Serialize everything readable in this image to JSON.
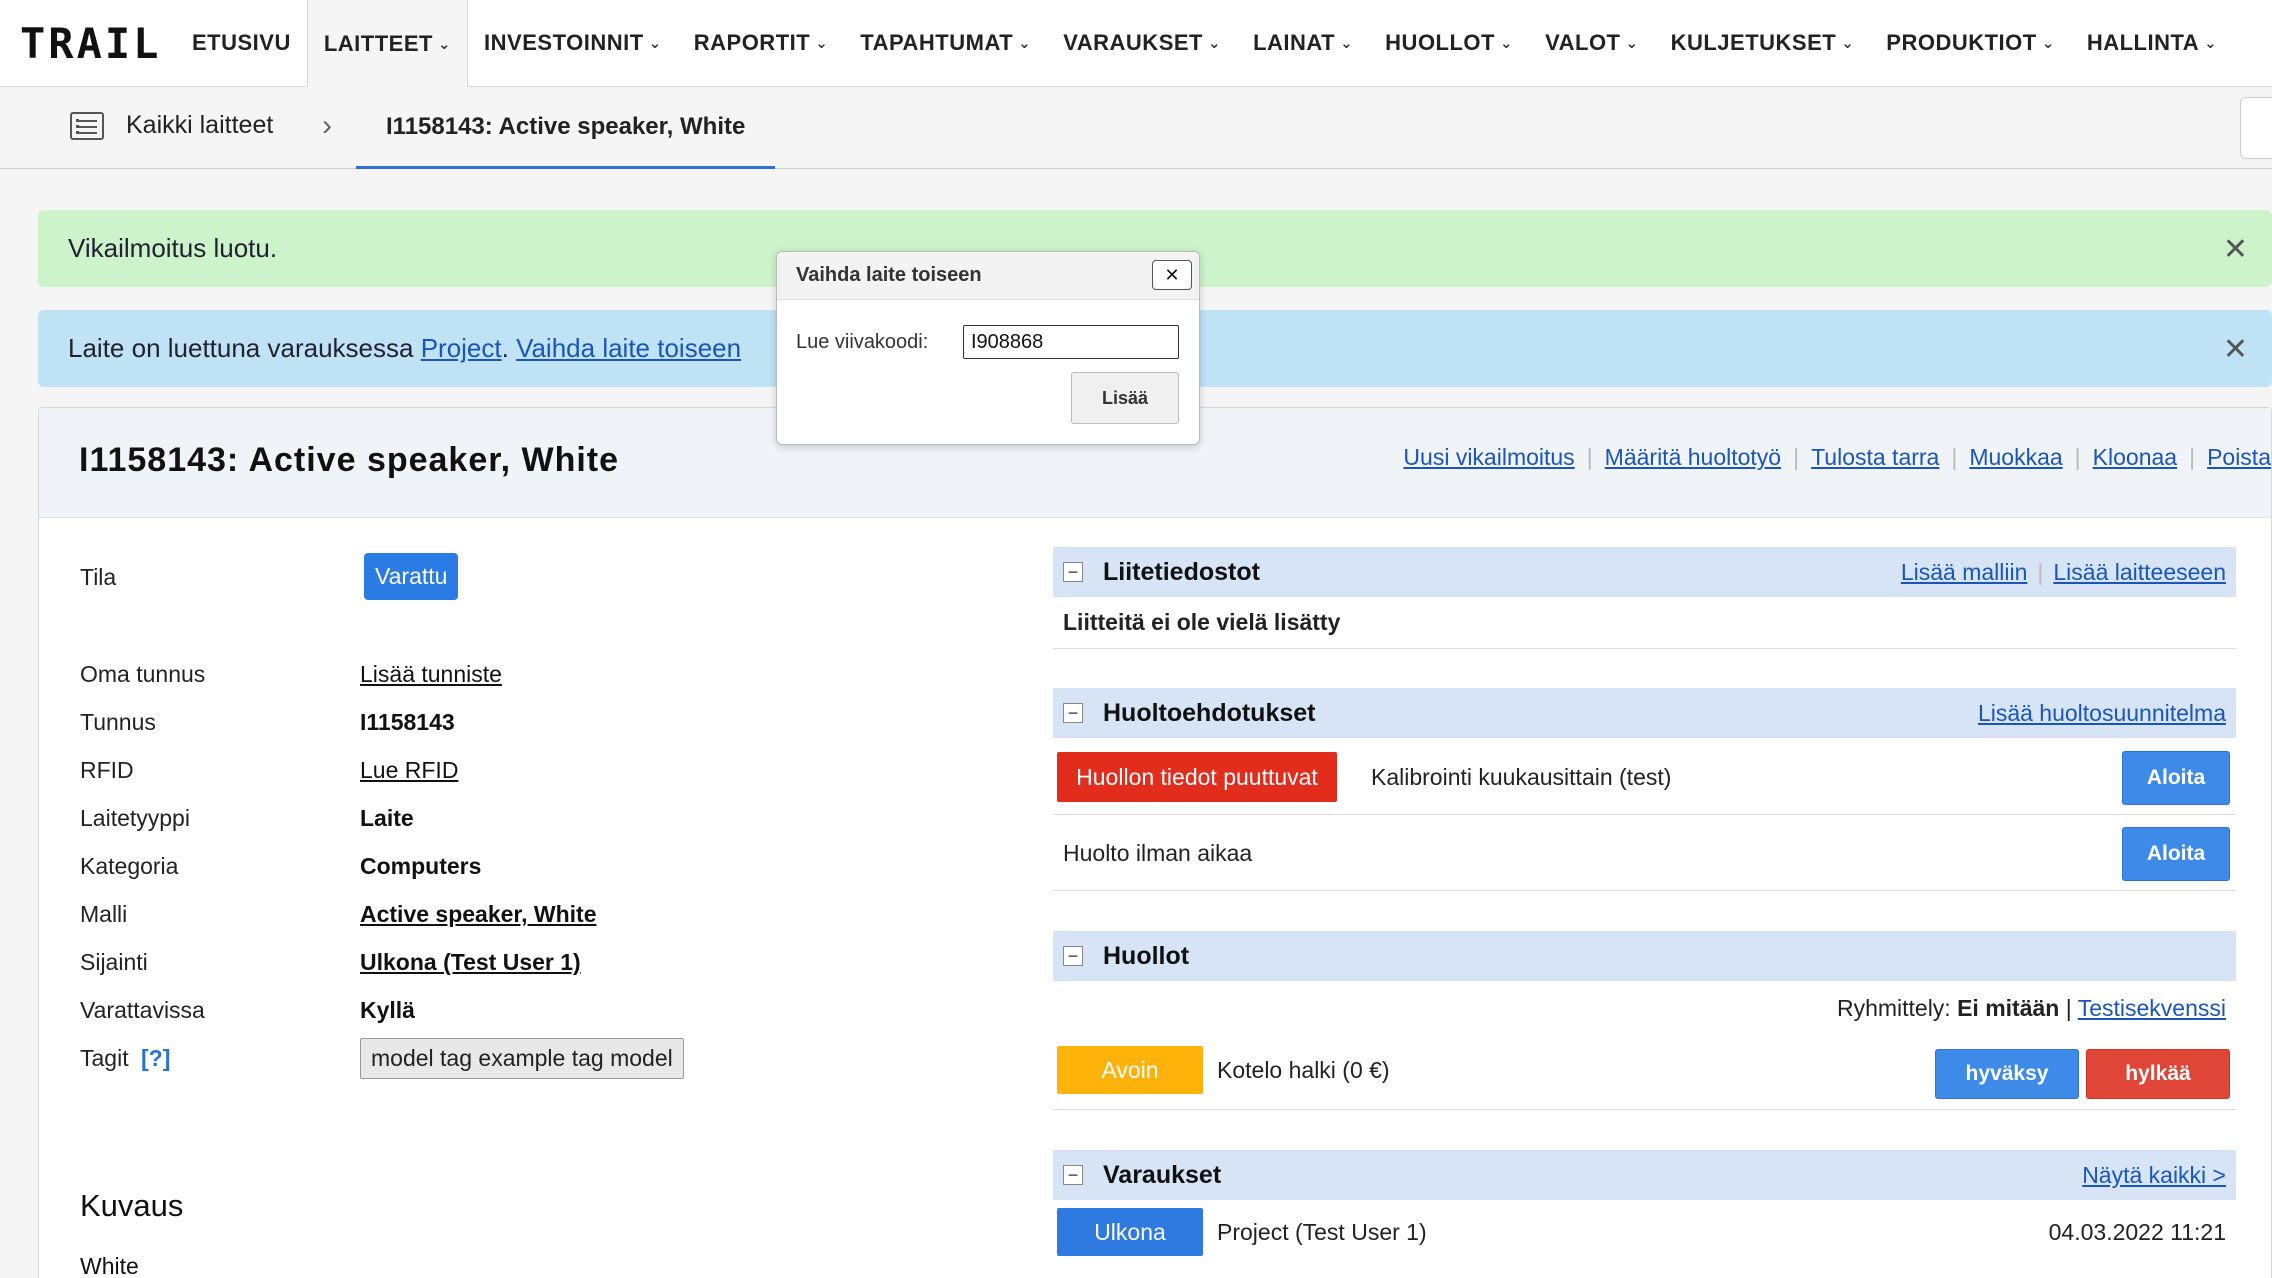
{
  "nav": {
    "logo": "TRAIL",
    "items": [
      {
        "label": "ETUSIVU",
        "has_menu": false
      },
      {
        "label": "LAITTEET",
        "has_menu": true
      },
      {
        "label": "INVESTOINNIT",
        "has_menu": true
      },
      {
        "label": "RAPORTIT",
        "has_menu": true
      },
      {
        "label": "TAPAHTUMAT",
        "has_menu": true
      },
      {
        "label": "VARAUKSET",
        "has_menu": true
      },
      {
        "label": "LAINAT",
        "has_menu": true
      },
      {
        "label": "HUOLLOT",
        "has_menu": true
      },
      {
        "label": "VALOT",
        "has_menu": true
      },
      {
        "label": "KULJETUKSET",
        "has_menu": true
      },
      {
        "label": "PRODUKTIOT",
        "has_menu": true
      },
      {
        "label": "HALLINTA",
        "has_menu": true
      }
    ],
    "active_item": "LAITTEET"
  },
  "breadcrumb": {
    "all_label": "Kaikki laitteet",
    "current": "I1158143: Active speaker, White"
  },
  "alerts": {
    "success": "Vikailmoitus luotu.",
    "info_prefix": "Laite on luettuna varauksessa ",
    "info_project_link": "Project",
    "info_dot": ". ",
    "info_change_link": "Vaihda laite toiseen",
    "close_glyph": "✕"
  },
  "modal": {
    "title": "Vaihda laite toiseen",
    "close_glyph": "✕",
    "barcode_label": "Lue viivakoodi:",
    "barcode_value": "I908868",
    "add_button": "Lisää"
  },
  "device": {
    "title": "I1158143: Active speaker, White",
    "actions": [
      "Uusi vikailmoitus",
      "Määritä huoltotyö",
      "Tulosta tarra",
      "Muokkaa",
      "Kloonaa",
      "Poista"
    ],
    "fields": {
      "status_label": "Tila",
      "status_value": "Varattu",
      "own_id_label": "Oma tunnus",
      "own_id_link": "Lisää tunniste",
      "id_label": "Tunnus",
      "id_value": "I1158143",
      "rfid_label": "RFID",
      "rfid_link": "Lue RFID",
      "type_label": "Laitetyyppi",
      "type_value": "Laite",
      "category_label": "Kategoria",
      "category_value": "Computers",
      "model_label": "Malli",
      "model_link": "Active speaker, White",
      "location_label": "Sijainti",
      "location_link": "Ulkona (Test User 1)",
      "reservable_label": "Varattavissa",
      "reservable_value": "Kyllä",
      "tags_label": "Tagit",
      "tags_help": "[?]",
      "tags_value": "model tag example tag model"
    },
    "description_title": "Kuvaus",
    "description_text": "White"
  },
  "attachments": {
    "title": "Liitetiedostot",
    "links": [
      "Lisää malliin",
      "Lisää laitteeseen"
    ],
    "empty_text": "Liitteitä ei ole vielä lisätty"
  },
  "maintenance_suggestions": {
    "title": "Huoltoehdotukset",
    "link": "Lisää huoltosuunnitelma",
    "rows": [
      {
        "badge": "Huollon tiedot puuttuvat",
        "text": "Kalibrointi kuukausittain (test)",
        "button": "Aloita"
      },
      {
        "badge": "",
        "text": "Huolto ilman aikaa",
        "button": "Aloita"
      }
    ]
  },
  "maintenances": {
    "title": "Huollot",
    "grouping_label": "Ryhmittely:",
    "grouping_value": "Ei mitään",
    "grouping_sep": "|",
    "grouping_link": "Testisekvenssi",
    "rows": [
      {
        "status": "Avoin",
        "text": "Kotelo halki (0 €)",
        "approve": "hyväksy",
        "reject": "hylkää"
      }
    ]
  },
  "reservations": {
    "title": "Varaukset",
    "link": "Näytä kaikki >",
    "rows": [
      {
        "status": "Ulkona",
        "text": "Project (Test User 1)",
        "date": "04.03.2022 11:21"
      }
    ]
  },
  "colors": {
    "accent": "#2b7be4",
    "success_bg": "#cdf3cb",
    "info_bg": "#bfe3f5",
    "section_bg": "#d6e4f6",
    "danger": "#e22c1c",
    "warning": "#ffb20a"
  }
}
